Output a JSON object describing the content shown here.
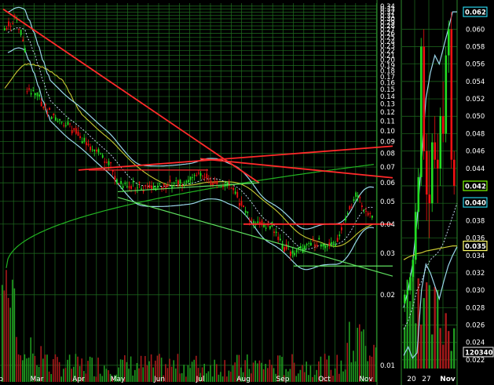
{
  "chart_data": [
    {
      "type": "candlestick",
      "title": "",
      "subtitle": "",
      "yscale": "log",
      "ylim": [
        0.0085,
        0.35
      ],
      "y_ticks": [
        0.34,
        0.33,
        0.32,
        0.31,
        0.3,
        0.29,
        0.28,
        0.27,
        0.26,
        0.25,
        0.24,
        0.23,
        0.22,
        0.21,
        0.2,
        0.19,
        0.18,
        0.17,
        0.16,
        0.15,
        0.14,
        0.13,
        0.12,
        0.11,
        0.1,
        0.09,
        0.08,
        0.07,
        0.06,
        0.05,
        0.04,
        0.03,
        0.02,
        0.01
      ],
      "y_tick_labels": [
        "0.34",
        "0.33",
        "0.32",
        "0.31",
        "0.30",
        "0.29",
        "0.28",
        "0.27",
        "0.26",
        "0.25",
        "0.24",
        "0.23",
        "0.22",
        "0.21",
        "0.20",
        "0.19",
        "0.18",
        "0.17",
        "0.16",
        "0.15",
        "0.14",
        "0.13",
        "0.12",
        "0.11",
        "0.10",
        "0.09",
        "0.08",
        "0.07",
        "0.06",
        "0.05",
        "0.04",
        "0.03",
        "0.02",
        "0.01"
      ],
      "x_tick_labels": [
        "Feb",
        "Mar",
        "Apr",
        "May",
        "Jun",
        "Jul",
        "Aug",
        "Sep",
        "Oct",
        "Nov"
      ],
      "grid": true,
      "price_path": [
        [
          "Feb",
          0.26
        ],
        [
          "Feb+",
          0.31
        ],
        [
          "Feb++",
          0.22
        ],
        [
          "Mar-",
          0.15
        ],
        [
          "Mar",
          0.14
        ],
        [
          "Mar+",
          0.12
        ],
        [
          "Apr-",
          0.105
        ],
        [
          "Apr",
          0.095
        ],
        [
          "Apr+",
          0.085
        ],
        [
          "May-",
          0.075
        ],
        [
          "May",
          0.06
        ],
        [
          "May+",
          0.058
        ],
        [
          "Jun",
          0.058
        ],
        [
          "Jun+",
          0.059
        ],
        [
          "Jul-",
          0.06
        ],
        [
          "Jul",
          0.066
        ],
        [
          "Jul+",
          0.06
        ],
        [
          "Aug-",
          0.057
        ],
        [
          "Aug",
          0.046
        ],
        [
          "Aug+",
          0.04
        ],
        [
          "Sep-",
          0.039
        ],
        [
          "Sep",
          0.032
        ],
        [
          "Sep+",
          0.03
        ],
        [
          "Oct-",
          0.034
        ],
        [
          "Oct",
          0.032
        ],
        [
          "Oct+",
          0.033
        ],
        [
          "Nov-",
          0.053
        ],
        [
          "Nov",
          0.045
        ],
        [
          "Nov+",
          0.041
        ]
      ],
      "trendlines": [
        {
          "color": "red",
          "from": [
            "Feb",
            0.33
          ],
          "to": [
            "Aug",
            0.06
          ]
        },
        {
          "color": "red",
          "from": [
            "Apr",
            0.068
          ],
          "to": [
            "Nov+",
            0.086
          ]
        },
        {
          "color": "red",
          "from": [
            "Jul",
            0.076
          ],
          "to": [
            "Nov+",
            0.063
          ]
        },
        {
          "color": "red",
          "from": [
            "Aug",
            0.04
          ],
          "to": [
            "Nov+",
            0.04
          ]
        },
        {
          "color": "green",
          "from": [
            "May",
            0.052
          ],
          "to": [
            "Nov+",
            0.024
          ]
        },
        {
          "color": "green",
          "from": [
            "May",
            0.055
          ],
          "to": [
            "Aug",
            0.06
          ]
        },
        {
          "color": "green",
          "from": [
            "Sep+",
            0.0265
          ],
          "to": [
            "Nov+",
            0.0265
          ]
        }
      ],
      "moving_averages": [
        {
          "color": "green",
          "shape": "rises from 0.025 to about 0.072"
        },
        {
          "color": "yellow",
          "shape": "rises to about 0.11, falls to about 0.036"
        },
        {
          "color": "cyan-dotted",
          "shape": "follows price"
        }
      ],
      "volume_bars": "green and red bars along bottom"
    },
    {
      "type": "candlestick",
      "title": "",
      "yscale": "linear",
      "ylim": [
        0.021,
        0.063
      ],
      "y_ticks": [
        0.06,
        0.058,
        0.056,
        0.054,
        0.052,
        0.05,
        0.048,
        0.046,
        0.044,
        0.042,
        0.04,
        0.038,
        0.036,
        0.034,
        0.032,
        0.03,
        0.028,
        0.026,
        0.024,
        0.022
      ],
      "y_tick_labels": [
        "0.060",
        "0.058",
        "0.056",
        "0.054",
        "0.052",
        "0.050",
        "0.048",
        "0.046",
        "0.044",
        "0.042",
        "0.040",
        "0.038",
        "0.036",
        "0.034",
        "0.032",
        "0.030",
        "0.028",
        "0.026",
        "0.024",
        "0.022"
      ],
      "x_tick_labels": [
        "20",
        "27",
        "Nov"
      ],
      "value_tags": [
        {
          "label": "0.062",
          "value": 0.062,
          "color": "#27d0e8"
        },
        {
          "label": "0.042",
          "value": 0.042,
          "color": "#7cfc00"
        },
        {
          "label": "0.040",
          "value": 0.0401,
          "color": "#27d0e8"
        },
        {
          "label": "0.035",
          "value": 0.0351,
          "color": "#ffff66"
        },
        {
          "label": "120340",
          "value": 0.0229,
          "color": "#cccccc"
        }
      ],
      "candles": [
        {
          "o": 0.0285,
          "h": 0.03,
          "l": 0.0275,
          "c": 0.0295,
          "up": true
        },
        {
          "o": 0.0295,
          "h": 0.031,
          "l": 0.028,
          "c": 0.03,
          "up": true
        },
        {
          "o": 0.03,
          "h": 0.032,
          "l": 0.0295,
          "c": 0.0315,
          "up": true
        },
        {
          "o": 0.0315,
          "h": 0.034,
          "l": 0.031,
          "c": 0.0335,
          "up": true
        },
        {
          "o": 0.0335,
          "h": 0.04,
          "l": 0.033,
          "c": 0.039,
          "up": true
        },
        {
          "o": 0.039,
          "h": 0.044,
          "l": 0.037,
          "c": 0.043,
          "up": true
        },
        {
          "o": 0.043,
          "h": 0.059,
          "l": 0.042,
          "c": 0.058,
          "up": true
        },
        {
          "o": 0.058,
          "h": 0.06,
          "l": 0.045,
          "c": 0.046,
          "up": false
        },
        {
          "o": 0.046,
          "h": 0.048,
          "l": 0.038,
          "c": 0.041,
          "up": false
        },
        {
          "o": 0.041,
          "h": 0.046,
          "l": 0.036,
          "c": 0.04,
          "up": false
        },
        {
          "o": 0.04,
          "h": 0.048,
          "l": 0.039,
          "c": 0.047,
          "up": true
        },
        {
          "o": 0.047,
          "h": 0.05,
          "l": 0.044,
          "c": 0.045,
          "up": false
        },
        {
          "o": 0.045,
          "h": 0.048,
          "l": 0.04,
          "c": 0.044,
          "up": false
        },
        {
          "o": 0.044,
          "h": 0.051,
          "l": 0.042,
          "c": 0.05,
          "up": true
        },
        {
          "o": 0.05,
          "h": 0.054,
          "l": 0.047,
          "c": 0.048,
          "up": false
        },
        {
          "o": 0.048,
          "h": 0.058,
          "l": 0.047,
          "c": 0.057,
          "up": true
        },
        {
          "o": 0.057,
          "h": 0.061,
          "l": 0.055,
          "c": 0.06,
          "up": true
        },
        {
          "o": 0.06,
          "h": 0.062,
          "l": 0.044,
          "c": 0.045,
          "up": false
        },
        {
          "o": 0.045,
          "h": 0.046,
          "l": 0.041,
          "c": 0.042,
          "up": false
        }
      ]
    }
  ],
  "colors": {
    "background": "#000000",
    "grid": "#1f6e1f",
    "up": "#22dd22",
    "down": "#ee1111",
    "trend_red": "#ff2a2a",
    "trend_green": "#5fe05f",
    "ma_green": "#22b522",
    "ma_yellow": "#c8c832",
    "bollinger": "#9ad6ea",
    "axis_text": "#ffffff"
  }
}
